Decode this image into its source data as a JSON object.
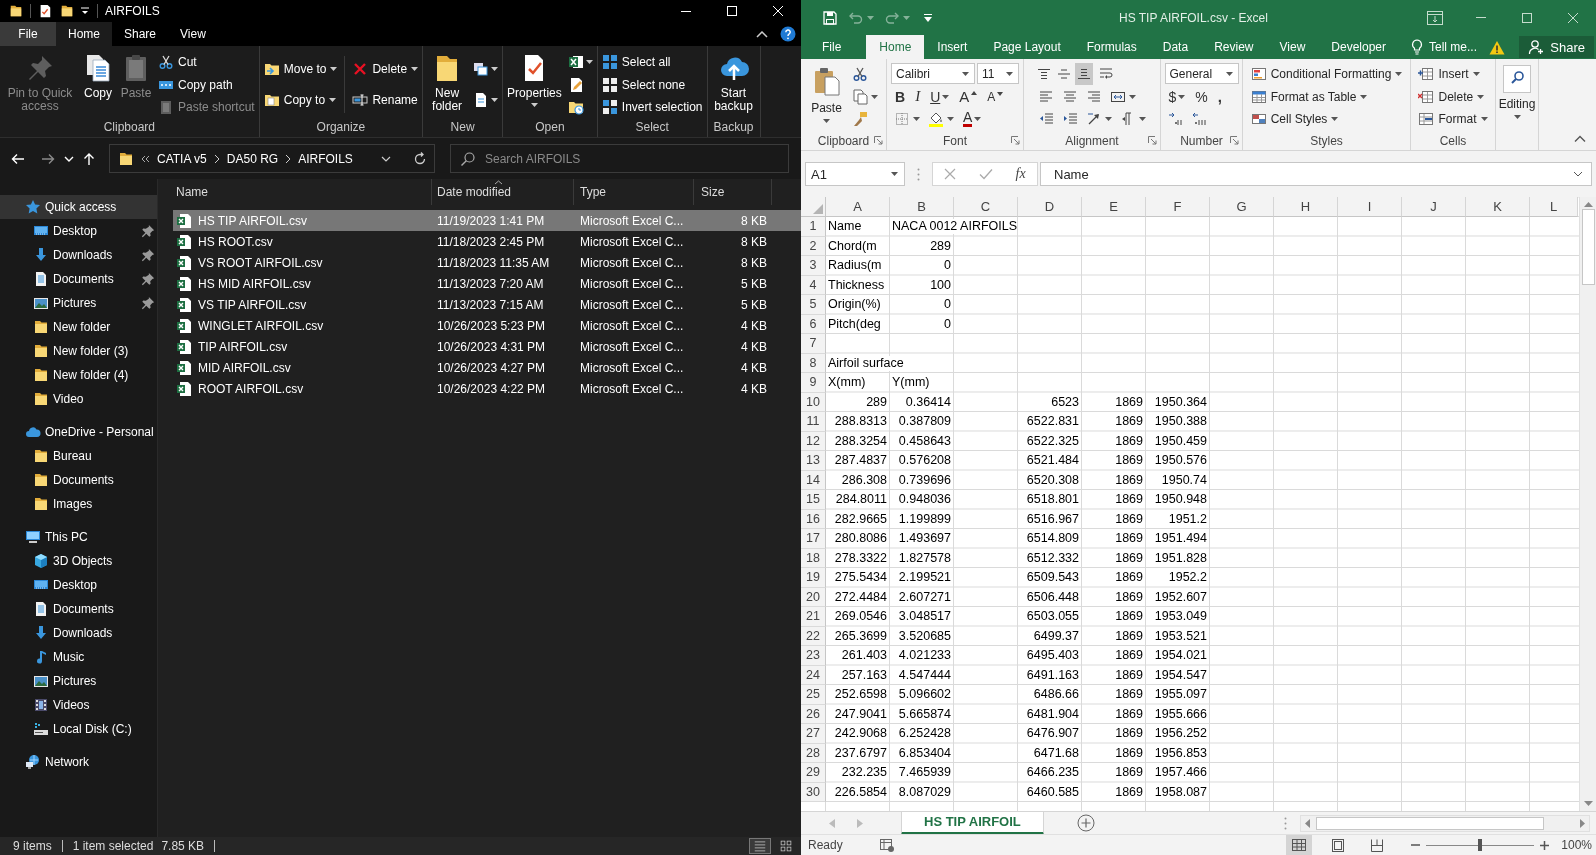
{
  "explorer": {
    "title": "AIRFOILS",
    "tabs": [
      {
        "label": "File",
        "kind": "menu",
        "selected": false
      },
      {
        "label": "Home",
        "kind": "tab",
        "selected": true
      },
      {
        "label": "Share",
        "kind": "tab",
        "selected": false
      },
      {
        "label": "View",
        "kind": "tab",
        "selected": false
      }
    ],
    "ribbon": [
      {
        "label": "Clipboard",
        "items": [
          {
            "kind": "large",
            "label": "Pin to Quick access",
            "disabled": true
          },
          {
            "kind": "large",
            "label": "Copy",
            "disabled": false
          },
          {
            "kind": "large",
            "label": "Paste",
            "disabled": true
          },
          {
            "kind": "stack",
            "items": [
              {
                "label": "Cut",
                "disabled": false
              },
              {
                "label": "Copy path",
                "disabled": false
              },
              {
                "label": "Paste shortcut",
                "disabled": true
              }
            ]
          }
        ]
      },
      {
        "label": "Organize",
        "items": [
          {
            "kind": "stack",
            "items": [
              {
                "label": "Move to",
                "dropdown": true,
                "disabled": false
              },
              {
                "label": "Copy to",
                "dropdown": true,
                "disabled": false
              }
            ]
          },
          {
            "kind": "stack",
            "items": [
              {
                "label": "Delete",
                "dropdown": true,
                "disabled": false
              },
              {
                "label": "Rename",
                "disabled": false
              }
            ]
          }
        ]
      },
      {
        "label": "New",
        "items": [
          {
            "kind": "large",
            "label": "New folder",
            "disabled": false
          },
          {
            "kind": "stack",
            "items": [
              {
                "dropdown": true,
                "disabled": false
              },
              {
                "dropdown": true,
                "disabled": false
              }
            ]
          }
        ]
      },
      {
        "label": "Open",
        "items": [
          {
            "kind": "large",
            "label": "Properties",
            "dropdown": true,
            "disabled": false
          },
          {
            "kind": "stack",
            "items": [
              {
                "dropdown": true,
                "disabled": false
              },
              {
                "disabled": false
              },
              {
                "disabled": false
              }
            ]
          }
        ]
      },
      {
        "label": "Select",
        "items": [
          {
            "kind": "stack",
            "items": [
              {
                "label": "Select all",
                "disabled": false
              },
              {
                "label": "Select none",
                "disabled": false
              },
              {
                "label": "Invert selection",
                "disabled": false
              }
            ]
          }
        ]
      },
      {
        "label": "Backup",
        "items": [
          {
            "kind": "large",
            "label": "Start backup",
            "disabled": false
          }
        ]
      }
    ],
    "address": {
      "path": [
        "CATIA v5",
        "DA50 RG",
        "AIRFOILS"
      ],
      "search_placeholder": "Search AIRFOILS"
    },
    "navigation": [
      {
        "label": "Quick access",
        "kind": "star",
        "selected": true,
        "children": [
          {
            "label": "Desktop",
            "kind": "desktop",
            "pinned": true,
            "selected": false
          },
          {
            "label": "Downloads",
            "kind": "downloads",
            "pinned": true,
            "selected": false
          },
          {
            "label": "Documents",
            "kind": "documents",
            "pinned": true,
            "selected": false
          },
          {
            "label": "Pictures",
            "kind": "pictures",
            "pinned": true,
            "selected": false
          },
          {
            "label": "New folder",
            "kind": "folder",
            "pinned": false,
            "selected": false
          },
          {
            "label": "New folder (3)",
            "kind": "folder",
            "pinned": false,
            "selected": false
          },
          {
            "label": "New folder (4)",
            "kind": "folder",
            "pinned": false,
            "selected": false
          },
          {
            "label": "Video",
            "kind": "folder",
            "pinned": false,
            "selected": false
          }
        ]
      },
      {
        "label": "OneDrive - Personal",
        "kind": "cloud",
        "selected": false,
        "children": [
          {
            "label": "Bureau",
            "kind": "folder",
            "selected": false
          },
          {
            "label": "Documents",
            "kind": "folder",
            "selected": false
          },
          {
            "label": "Images",
            "kind": "folder",
            "selected": false
          }
        ]
      },
      {
        "label": "This PC",
        "kind": "pc",
        "selected": false,
        "children": [
          {
            "label": "3D Objects",
            "kind": "cube",
            "selected": false
          },
          {
            "label": "Desktop",
            "kind": "desktop",
            "selected": false
          },
          {
            "label": "Documents",
            "kind": "documents",
            "selected": false
          },
          {
            "label": "Downloads",
            "kind": "downloads",
            "selected": false
          },
          {
            "label": "Music",
            "kind": "music",
            "selected": false
          },
          {
            "label": "Pictures",
            "kind": "pictures",
            "selected": false
          },
          {
            "label": "Videos",
            "kind": "videos",
            "selected": false
          },
          {
            "label": "Local Disk (C:)",
            "kind": "disk",
            "selected": false
          }
        ]
      },
      {
        "label": "Network",
        "kind": "network",
        "selected": false
      }
    ],
    "file_list": {
      "columns": [
        {
          "label": "Name",
          "sorted": false
        },
        {
          "label": "Date modified",
          "sorted": true
        },
        {
          "label": "Type",
          "sorted": false
        },
        {
          "label": "Size",
          "sorted": false
        }
      ],
      "files": [
        {
          "name": "HS TIP AIRFOIL.csv",
          "date": "11/19/2023 1:41 PM",
          "type": "Microsoft Excel C...",
          "size": "8 KB",
          "selected": true
        },
        {
          "name": "HS ROOT.csv",
          "date": "11/18/2023 2:45 PM",
          "type": "Microsoft Excel C...",
          "size": "8 KB",
          "selected": false
        },
        {
          "name": "VS ROOT AIRFOIL.csv",
          "date": "11/18/2023 11:35 AM",
          "type": "Microsoft Excel C...",
          "size": "8 KB",
          "selected": false
        },
        {
          "name": "HS MID AIRFOIL.csv",
          "date": "11/13/2023 7:20 AM",
          "type": "Microsoft Excel C...",
          "size": "5 KB",
          "selected": false
        },
        {
          "name": "VS TIP AIRFOIL.csv",
          "date": "11/13/2023 7:15 AM",
          "type": "Microsoft Excel C...",
          "size": "5 KB",
          "selected": false
        },
        {
          "name": "WINGLET AIRFOIL.csv",
          "date": "10/26/2023 5:23 PM",
          "type": "Microsoft Excel C...",
          "size": "4 KB",
          "selected": false
        },
        {
          "name": "TIP AIRFOIL.csv",
          "date": "10/26/2023 4:31 PM",
          "type": "Microsoft Excel C...",
          "size": "4 KB",
          "selected": false
        },
        {
          "name": "MID AIRFOIL.csv",
          "date": "10/26/2023 4:27 PM",
          "type": "Microsoft Excel C...",
          "size": "4 KB",
          "selected": false
        },
        {
          "name": "ROOT AIRFOIL.csv",
          "date": "10/26/2023 4:22 PM",
          "type": "Microsoft Excel C...",
          "size": "4 KB",
          "selected": false
        }
      ]
    },
    "status_bar": {
      "items": "9 items",
      "selection": "1 item selected",
      "size": "7.85 KB",
      "view_buttons": [
        {
          "selected": true
        },
        {
          "selected": false
        }
      ]
    }
  },
  "excel": {
    "title": "HS TIP AIRFOIL.csv - Excel",
    "quick_access": [
      {
        "disabled": false
      },
      {
        "disabled": true
      },
      {
        "disabled": true
      }
    ],
    "tabs": [
      {
        "label": "File",
        "selected": false
      },
      {
        "label": "Home",
        "selected": true
      },
      {
        "label": "Insert",
        "selected": false
      },
      {
        "label": "Page Layout",
        "selected": false
      },
      {
        "label": "Formulas",
        "selected": false
      },
      {
        "label": "Data",
        "selected": false
      },
      {
        "label": "Review",
        "selected": false
      },
      {
        "label": "View",
        "selected": false
      },
      {
        "label": "Developer",
        "selected": false
      }
    ],
    "tell_me": "Tell me...",
    "share": "Share",
    "ribbon": [
      {
        "label": "Clipboard",
        "launcher": true,
        "kind": "items",
        "items": [
          {
            "kind": "large",
            "label": "Paste",
            "dropdown": true
          },
          {
            "kind": "stack",
            "items": [
              {
                "kind": "icon"
              },
              {
                "kind": "icon",
                "dropdown": true
              },
              {
                "kind": "icon"
              }
            ]
          }
        ]
      },
      {
        "label": "Font",
        "launcher": true,
        "kind": "rows",
        "rows": [
          {
            "items": [
              {
                "kind": "field",
                "value": "Calibri"
              },
              {
                "kind": "field",
                "value": "11"
              }
            ]
          },
          {
            "items": [
              {
                "kind": "glyph",
                "label": "B"
              },
              {
                "kind": "glyph",
                "label": "I"
              },
              {
                "kind": "glyph",
                "label": "U",
                "dropdown": true
              },
              {
                "kind": "glyph",
                "label": "A"
              },
              {
                "kind": "glyph",
                "label": "A"
              }
            ]
          },
          {
            "items": [
              {
                "kind": "icon",
                "dropdown": true
              },
              {
                "kind": "icon",
                "dropdown": true
              },
              {
                "kind": "glyph",
                "label": "A",
                "dropdown": true
              }
            ]
          }
        ]
      },
      {
        "label": "Alignment",
        "launcher": true,
        "kind": "rows",
        "rows": [
          {
            "items": [
              {
                "kind": "icon",
                "on": false
              },
              {
                "kind": "icon",
                "on": false
              },
              {
                "kind": "icon",
                "on": true
              },
              {
                "kind": "icon",
                "on": false
              }
            ]
          },
          {
            "items": [
              {
                "kind": "icon",
                "on": false
              },
              {
                "kind": "icon",
                "on": false
              },
              {
                "kind": "icon",
                "on": false
              },
              {
                "kind": "icon",
                "dropdown": true,
                "on": false
              }
            ]
          },
          {
            "items": [
              {
                "kind": "icon"
              },
              {
                "kind": "icon"
              },
              {
                "kind": "icon",
                "dropdown": true
              },
              {
                "kind": "icon",
                "dropdown": true
              }
            ]
          }
        ]
      },
      {
        "label": "Number",
        "launcher": true,
        "kind": "rows",
        "rows": [
          {
            "items": [
              {
                "kind": "field",
                "value": "General"
              }
            ]
          },
          {
            "items": [
              {
                "kind": "glyph",
                "label": "$",
                "dropdown": true
              },
              {
                "kind": "glyph",
                "label": "%"
              },
              {
                "kind": "glyph",
                "label": ","
              }
            ]
          },
          {
            "items": [
              {
                "kind": "icon"
              },
              {
                "kind": "icon"
              }
            ]
          }
        ]
      },
      {
        "label": "Styles",
        "launcher": false,
        "kind": "items",
        "items": [
          {
            "kind": "stack",
            "items": [
              {
                "label": "Conditional Formatting",
                "dropdown": true
              },
              {
                "label": "Format as Table",
                "dropdown": true
              },
              {
                "label": "Cell Styles",
                "dropdown": true
              }
            ]
          }
        ]
      },
      {
        "label": "Cells",
        "launcher": false,
        "kind": "items",
        "items": [
          {
            "kind": "stack",
            "items": [
              {
                "label": "Insert",
                "dropdown": true
              },
              {
                "label": "Delete",
                "dropdown": true
              },
              {
                "label": "Format",
                "dropdown": true
              }
            ]
          }
        ]
      },
      {
        "launcher": false,
        "kind": "items",
        "items": [
          {
            "kind": "large",
            "label": "Editing",
            "dropdown": true
          }
        ]
      }
    ],
    "formula_bar": {
      "name_box": "A1",
      "function_label": "fx",
      "formula": "Name"
    },
    "sheet": {
      "columns": [
        "A",
        "B",
        "C",
        "D",
        "E",
        "F",
        "G",
        "H",
        "I",
        "J",
        "K",
        "L"
      ],
      "rows": [
        {
          "number": "1",
          "cells": [
            "Name",
            "NACA 0012 AIRFOILS"
          ]
        },
        {
          "number": "2",
          "cells": [
            "Chord(m",
            "289"
          ]
        },
        {
          "number": "3",
          "cells": [
            "Radius(m",
            "0"
          ]
        },
        {
          "number": "4",
          "cells": [
            "Thickness",
            "100"
          ]
        },
        {
          "number": "5",
          "cells": [
            "Origin(%)",
            "0"
          ]
        },
        {
          "number": "6",
          "cells": [
            "Pitch(deg",
            "0"
          ]
        },
        {
          "number": "7"
        },
        {
          "number": "8",
          "cells": [
            "Airfoil surface"
          ]
        },
        {
          "number": "9",
          "cells": [
            "X(mm)",
            "Y(mm)"
          ]
        },
        {
          "number": "10",
          "cells": [
            "289",
            "0.36414",
            null,
            "6523",
            "1869",
            "1950.364"
          ]
        },
        {
          "number": "11",
          "cells": [
            "288.8313",
            "0.387809",
            null,
            "6522.831",
            "1869",
            "1950.388"
          ]
        },
        {
          "number": "12",
          "cells": [
            "288.3254",
            "0.458643",
            null,
            "6522.325",
            "1869",
            "1950.459"
          ]
        },
        {
          "number": "13",
          "cells": [
            "287.4837",
            "0.576208",
            null,
            "6521.484",
            "1869",
            "1950.576"
          ]
        },
        {
          "number": "14",
          "cells": [
            "286.308",
            "0.739696",
            null,
            "6520.308",
            "1869",
            "1950.74"
          ]
        },
        {
          "number": "15",
          "cells": [
            "284.8011",
            "0.948036",
            null,
            "6518.801",
            "1869",
            "1950.948"
          ]
        },
        {
          "number": "16",
          "cells": [
            "282.9665",
            "1.199899",
            null,
            "6516.967",
            "1869",
            "1951.2"
          ]
        },
        {
          "number": "17",
          "cells": [
            "280.8086",
            "1.493697",
            null,
            "6514.809",
            "1869",
            "1951.494"
          ]
        },
        {
          "number": "18",
          "cells": [
            "278.3322",
            "1.827578",
            null,
            "6512.332",
            "1869",
            "1951.828"
          ]
        },
        {
          "number": "19",
          "cells": [
            "275.5434",
            "2.199521",
            null,
            "6509.543",
            "1869",
            "1952.2"
          ]
        },
        {
          "number": "20",
          "cells": [
            "272.4484",
            "2.607271",
            null,
            "6506.448",
            "1869",
            "1952.607"
          ]
        },
        {
          "number": "21",
          "cells": [
            "269.0546",
            "3.048517",
            null,
            "6503.055",
            "1869",
            "1953.049"
          ]
        },
        {
          "number": "22",
          "cells": [
            "265.3699",
            "3.520685",
            null,
            "6499.37",
            "1869",
            "1953.521"
          ]
        },
        {
          "number": "23",
          "cells": [
            "261.403",
            "4.021233",
            null,
            "6495.403",
            "1869",
            "1954.021"
          ]
        },
        {
          "number": "24",
          "cells": [
            "257.163",
            "4.547444",
            null,
            "6491.163",
            "1869",
            "1954.547"
          ]
        },
        {
          "number": "25",
          "cells": [
            "252.6598",
            "5.096602",
            null,
            "6486.66",
            "1869",
            "1955.097"
          ]
        },
        {
          "number": "26",
          "cells": [
            "247.9041",
            "5.665874",
            null,
            "6481.904",
            "1869",
            "1955.666"
          ]
        },
        {
          "number": "27",
          "cells": [
            "242.9068",
            "6.252428",
            null,
            "6476.907",
            "1869",
            "1956.252"
          ]
        },
        {
          "number": "28",
          "cells": [
            "237.6797",
            "6.853404",
            null,
            "6471.68",
            "1869",
            "1956.853"
          ]
        },
        {
          "number": "29",
          "cells": [
            "232.235",
            "7.465939",
            null,
            "6466.235",
            "1869",
            "1957.466"
          ]
        },
        {
          "number": "30",
          "cells": [
            "226.5854",
            "8.087029",
            null,
            "6460.585",
            "1869",
            "1958.087"
          ]
        }
      ]
    },
    "sheet_tabs": [
      {
        "label": "HS TIP AIRFOIL",
        "selected": true
      }
    ],
    "status_bar": {
      "text": "Ready",
      "view_buttons": [
        {
          "selected": true
        },
        {
          "selected": false
        },
        {
          "selected": false
        }
      ],
      "zoom": {
        "level": 0.5,
        "reading": "100%"
      }
    }
  }
}
